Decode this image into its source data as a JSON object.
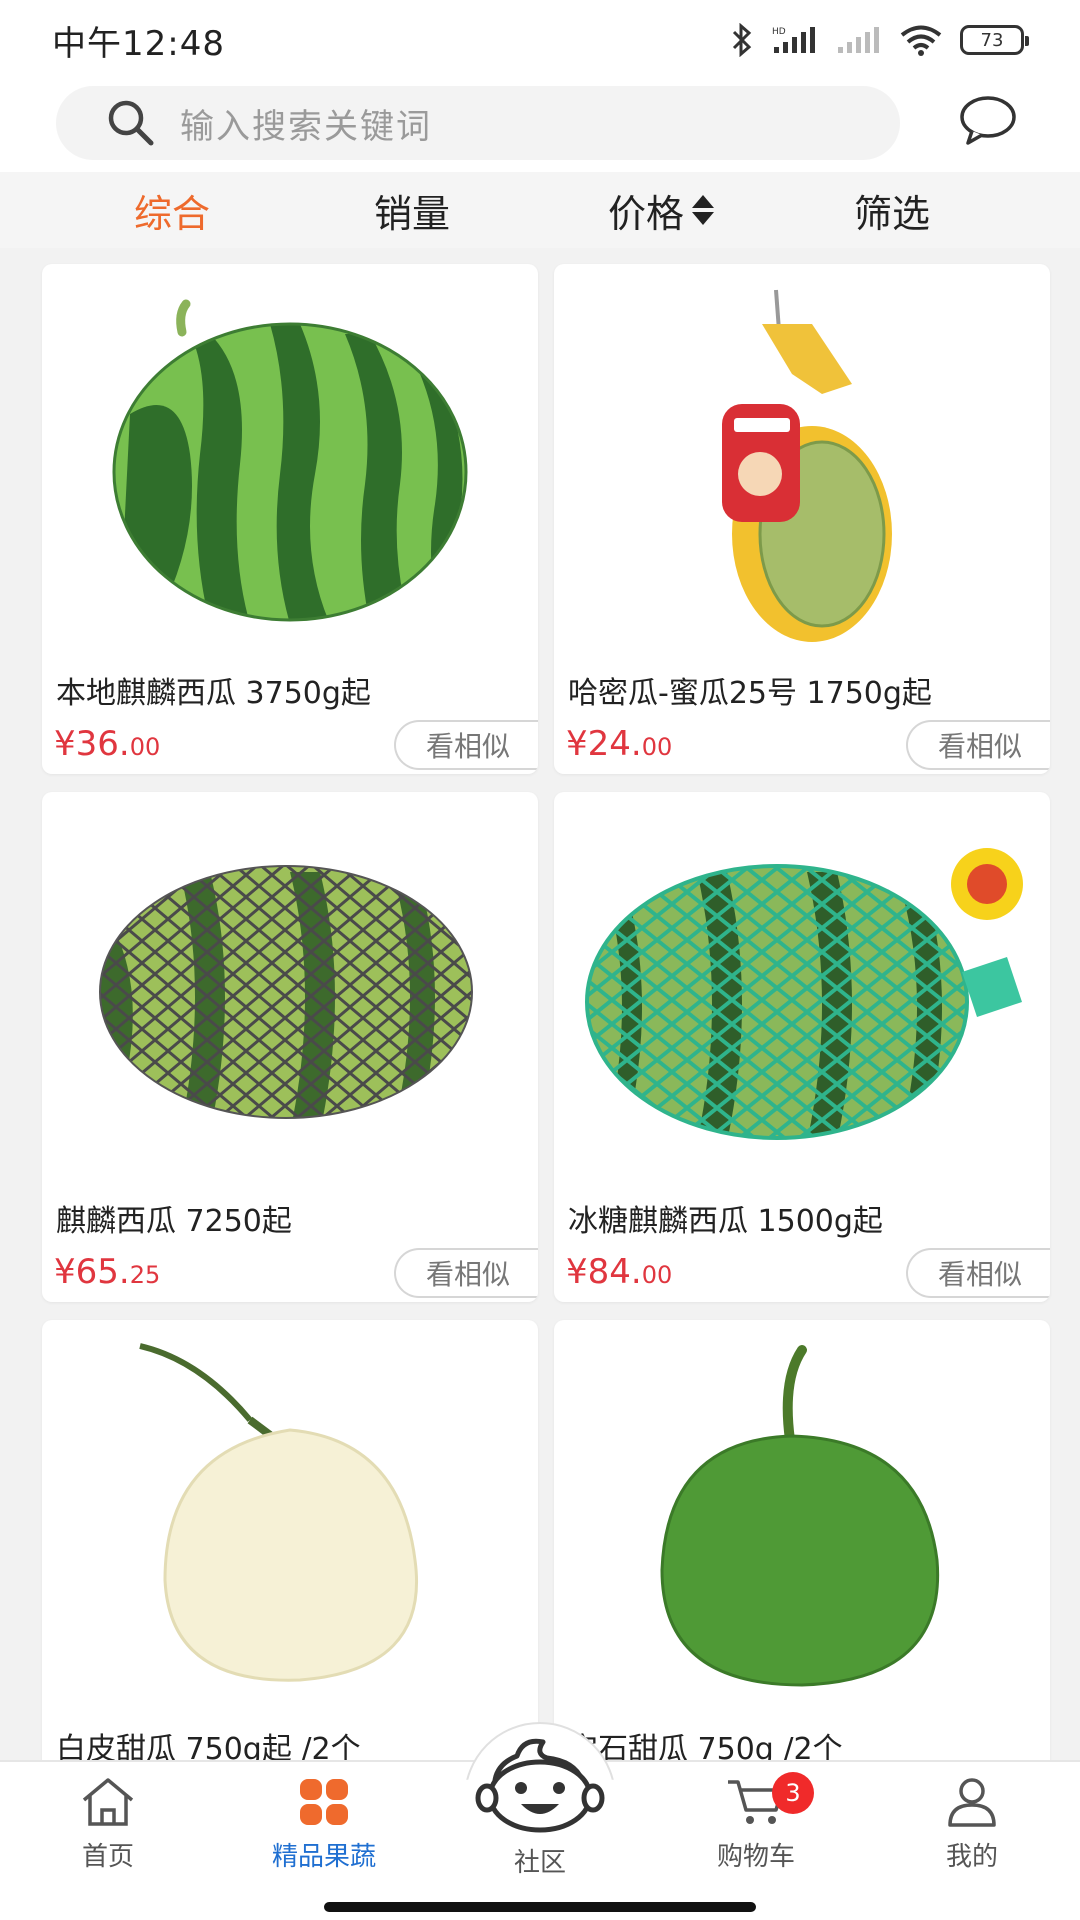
{
  "status_bar": {
    "time": "中午12:48",
    "battery": "73"
  },
  "search": {
    "placeholder": "输入搜索关键词"
  },
  "sort_tabs": [
    {
      "label": "综合",
      "active": true
    },
    {
      "label": "销量"
    },
    {
      "label": "价格"
    },
    {
      "label": "筛选"
    }
  ],
  "products": [
    {
      "name": "本地麒麟西瓜 3750g起",
      "price_int": "¥36.",
      "price_dec": "00",
      "similar": "看相似",
      "icon": "watermelon-image"
    },
    {
      "name": "哈密瓜-蜜瓜25号 1750g起",
      "price_int": "¥24.",
      "price_dec": "00",
      "similar": "看相似",
      "icon": "hami-melon-image"
    },
    {
      "name": "麒麟西瓜 7250起",
      "price_int": "¥65.",
      "price_dec": "25",
      "similar": "看相似",
      "icon": "netted-watermelon-image"
    },
    {
      "name": "冰糖麒麟西瓜 1500g起",
      "price_int": "¥84.",
      "price_dec": "00",
      "similar": "看相似",
      "icon": "green-netted-watermelon-image"
    },
    {
      "name": "白皮甜瓜 750g起 /2个",
      "icon": "white-melon-image"
    },
    {
      "name": "宝石甜瓜 750g /2个",
      "icon": "green-melon-image"
    }
  ],
  "bottom_nav": {
    "home": "首页",
    "produce": "精品果蔬",
    "community": "社区",
    "cart": "购物车",
    "cart_badge": "3",
    "mine": "我的"
  },
  "colors": {
    "accent": "#ee6a2c",
    "price": "#e0363f",
    "nav_active": "#1f6fd1"
  }
}
